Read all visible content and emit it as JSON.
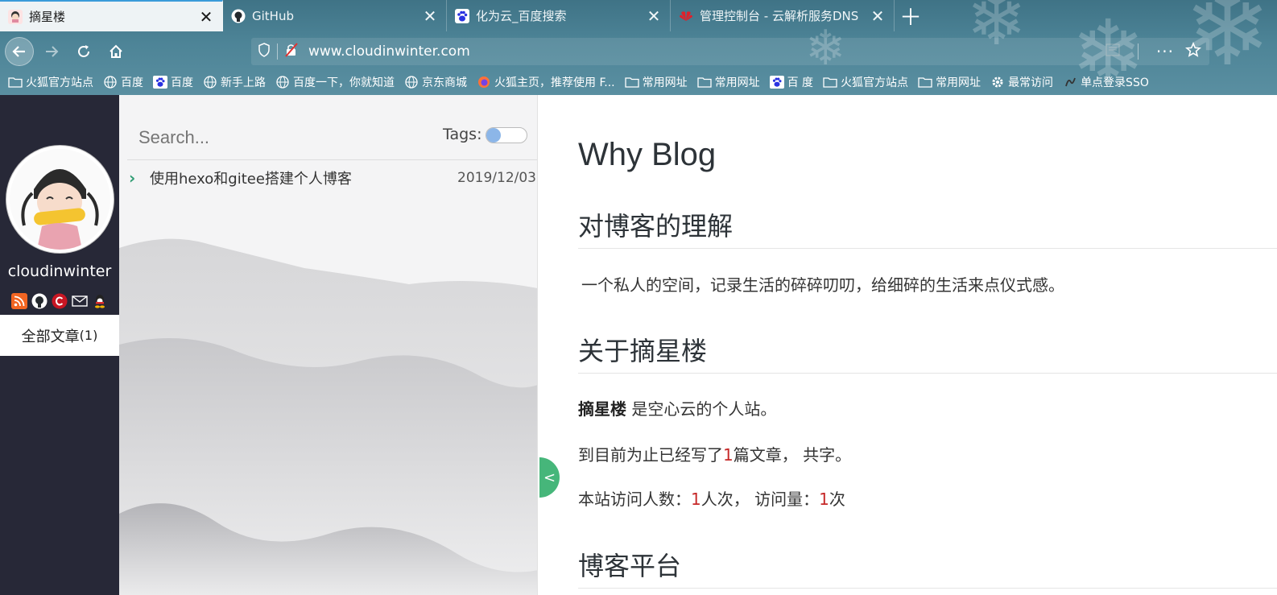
{
  "browser": {
    "tabs": [
      {
        "label": "摘星楼",
        "icon": "avatar-favicon-icon",
        "active": true
      },
      {
        "label": "GitHub",
        "icon": "github-icon",
        "active": false
      },
      {
        "label": "化为云_百度搜索",
        "icon": "baidu-paw-icon",
        "active": false
      },
      {
        "label": "管理控制台 - 云解析服务DNS",
        "icon": "huawei-icon",
        "active": false
      }
    ],
    "url": "www.cloudinwinter.com",
    "bookmarks": [
      {
        "label": "火狐官方站点",
        "icon": "folder-icon"
      },
      {
        "label": "百度",
        "icon": "globe-icon"
      },
      {
        "label": "百度",
        "icon": "baidu-paw-icon"
      },
      {
        "label": "新手上路",
        "icon": "globe-icon"
      },
      {
        "label": "百度一下，你就知道",
        "icon": "globe-icon"
      },
      {
        "label": "京东商城",
        "icon": "globe-icon"
      },
      {
        "label": "火狐主页，推荐使用 F...",
        "icon": "firefox-icon"
      },
      {
        "label": "常用网址",
        "icon": "folder-icon"
      },
      {
        "label": "常用网址",
        "icon": "folder-icon"
      },
      {
        "label": "百 度",
        "icon": "baidu-paw-icon"
      },
      {
        "label": "火狐官方站点",
        "icon": "folder-icon"
      },
      {
        "label": "常用网址",
        "icon": "folder-icon"
      },
      {
        "label": "最常访问",
        "icon": "gear-icon"
      },
      {
        "label": "单点登录SSO",
        "icon": "sso-icon"
      }
    ]
  },
  "sidebar": {
    "username": "cloudinwinter",
    "all_posts_label": "全部文章",
    "all_posts_count": "(1)",
    "social_icons": [
      "rss-icon",
      "github-icon",
      "csdn-icon",
      "mail-icon",
      "qq-icon"
    ]
  },
  "list": {
    "search_placeholder": "Search...",
    "tags_label": "Tags:",
    "posts": [
      {
        "title": "使用hexo和gitee搭建个人博客",
        "date": "2019/12/03"
      }
    ],
    "collapse_label": "<"
  },
  "article": {
    "title": "Why Blog",
    "sections": {
      "understanding_heading": "对博客的理解",
      "understanding_text": "一个私人的空间，记录生活的碎碎叨叨，给细碎的生活来点仪式感。",
      "about_heading": "关于摘星楼",
      "about_bold": "摘星楼",
      "about_text": " 是空心云的个人站。",
      "stats_prefix": "到目前为止已经写了",
      "stats_count": "1",
      "stats_suffix": "篇文章， 共字。",
      "visits_prefix": "本站访问人数：",
      "visits_count": "1",
      "visits_mid": "人次， 访问量：",
      "views_count": "1",
      "visits_suffix": "次",
      "platform_heading": "博客平台"
    }
  },
  "colors": {
    "chrome": "#4d8497",
    "sidebar": "#272837",
    "accent_green": "#46b67a",
    "stat_red": "#c62828"
  }
}
